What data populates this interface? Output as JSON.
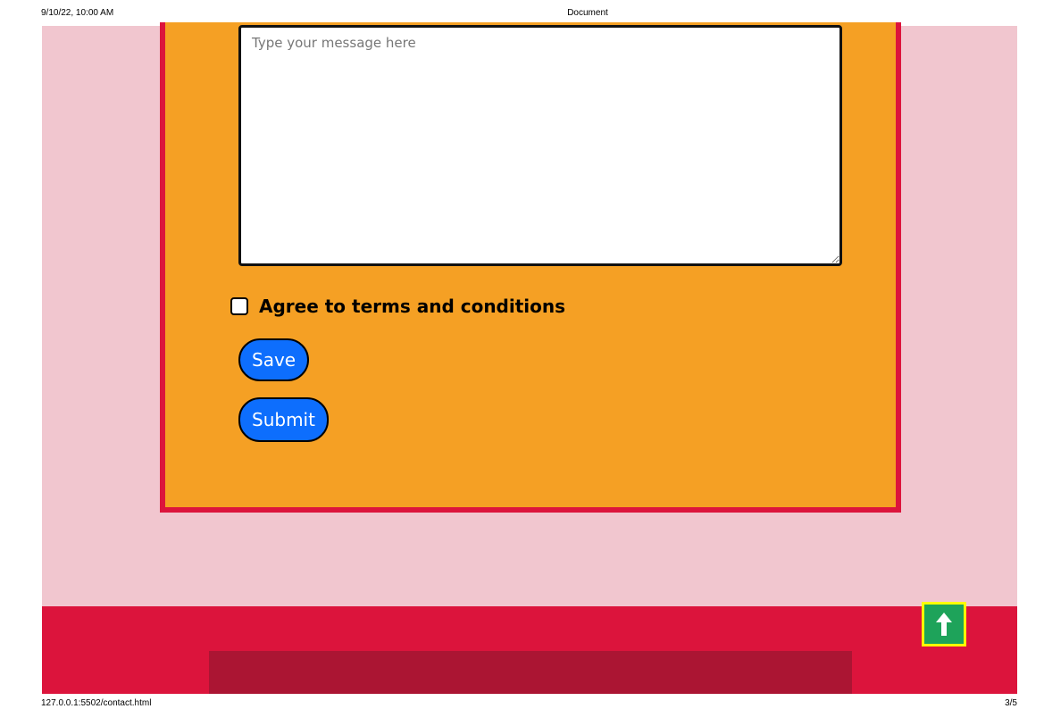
{
  "print_header": {
    "datetime": "9/10/22, 10:00 AM",
    "title": "Document"
  },
  "print_footer": {
    "url": "127.0.0.1:5502/contact.html",
    "page": "3/5"
  },
  "form": {
    "message_placeholder": "Type your message here",
    "message_value": "",
    "terms_label": "Agree to terms and conditions",
    "terms_checked": false,
    "save_label": "Save",
    "submit_label": "Submit"
  },
  "footer": {
    "back_to_top_icon": "arrow-up-icon"
  },
  "colors": {
    "page_background": "#f1c6cf",
    "form_background": "#f5a024",
    "form_border": "#dc143c",
    "button_blue": "#0d6efd",
    "footer_red": "#dc143c",
    "footer_inner": "#ab1533",
    "to_top_green": "#1ea35a",
    "to_top_border": "#ffff00"
  }
}
